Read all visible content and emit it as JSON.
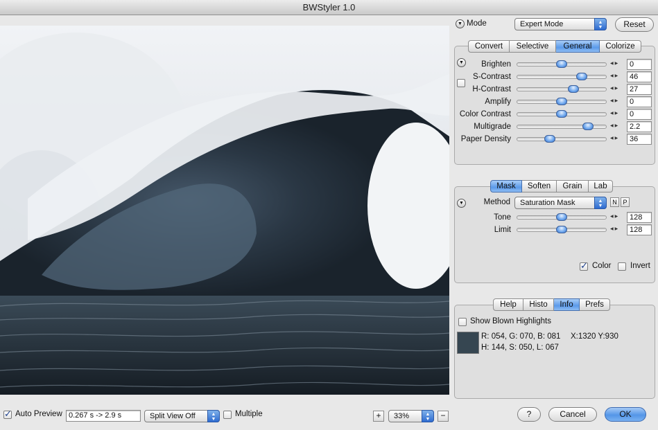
{
  "window": {
    "title": "BWStyler 1.0"
  },
  "mode": {
    "label": "Mode",
    "value": "Expert Mode",
    "reset_label": "Reset"
  },
  "general_tabs": [
    "Convert",
    "Selective",
    "General",
    "Colorize"
  ],
  "general_active": "General",
  "sliders": [
    {
      "label": "Brighten",
      "value": "0",
      "level": 0.5
    },
    {
      "label": "S-Contrast",
      "value": "46",
      "level": 0.73
    },
    {
      "label": "H-Contrast",
      "value": "27",
      "level": 0.63
    },
    {
      "label": "Amplify",
      "value": "0",
      "level": 0.5
    },
    {
      "label": "Color Contrast",
      "value": "0",
      "level": 0.5
    },
    {
      "label": "Multigrade",
      "value": "2.2",
      "level": 0.8
    },
    {
      "label": "Paper Density",
      "value": "36",
      "level": 0.37
    }
  ],
  "mask_tabs": [
    "Mask",
    "Soften",
    "Grain",
    "Lab"
  ],
  "mask_active": "Mask",
  "mask": {
    "method_label": "Method",
    "method_value": "Saturation Mask",
    "n_label": "N",
    "p_label": "P",
    "tone": {
      "label": "Tone",
      "value": "128",
      "level": 0.5
    },
    "limit": {
      "label": "Limit",
      "value": "128",
      "level": 0.5
    },
    "color_label": "Color",
    "color_checked": true,
    "invert_label": "Invert",
    "invert_checked": false
  },
  "info_tabs": [
    "Help",
    "Histo",
    "Info",
    "Prefs"
  ],
  "info_active": "Info",
  "info": {
    "blown_label": "Show Blown Highlights",
    "rgb_line": "R: 054, G: 070, B: 081",
    "xy_line": "X:1320  Y:930",
    "hsl_line": "H: 144, S: 050, L: 067",
    "swatch_color": "#364651"
  },
  "bottom": {
    "auto_preview_label": "Auto Preview",
    "timing": "0.267 s -> 2.9 s",
    "split_view": "Split View Off",
    "multiple_label": "Multiple",
    "zoom_in": "+",
    "zoom": "33%",
    "zoom_out": "−",
    "help": "?",
    "cancel": "Cancel",
    "ok": "OK"
  }
}
